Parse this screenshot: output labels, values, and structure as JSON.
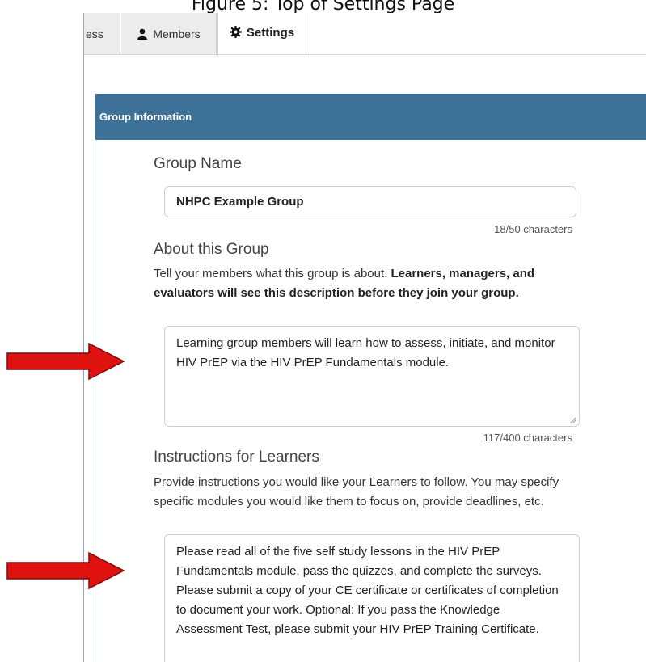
{
  "caption": "Figure 5: Top of Settings Page",
  "tabs": [
    {
      "label": "ess",
      "icon": "none"
    },
    {
      "label": "Members",
      "icon": "person-icon"
    },
    {
      "label": "Settings",
      "icon": "gear-icon"
    }
  ],
  "panel": {
    "title": "Group Information",
    "header_color": "#3e7198"
  },
  "group_name": {
    "label": "Group Name",
    "value": "NHPC Example Group",
    "counter": "18/50 characters"
  },
  "about": {
    "label": "About this Group",
    "help_plain": "Tell your members what this group is about. ",
    "help_bold": "Learners, managers, and evaluators will see this description before they join your group.",
    "value": "Learning group members will learn how to assess, initiate, and monitor HIV PrEP via the HIV PrEP Fundamentals module.",
    "counter": "117/400 characters"
  },
  "instructions": {
    "label": "Instructions for Learners",
    "help": "Provide instructions you would like your Learners to follow. You may specify specific modules you would like them to focus on, provide deadlines, etc.",
    "value": "Please read all of the five self study lessons in the HIV PrEP Fundamentals module, pass the quizzes, and complete the surveys. Please submit a copy of your CE certificate or certificates of completion to document your work. Optional: If you pass the Knowledge Assessment Test, please submit your HIV PrEP Training Certificate."
  },
  "arrow_color": "#e0120f"
}
